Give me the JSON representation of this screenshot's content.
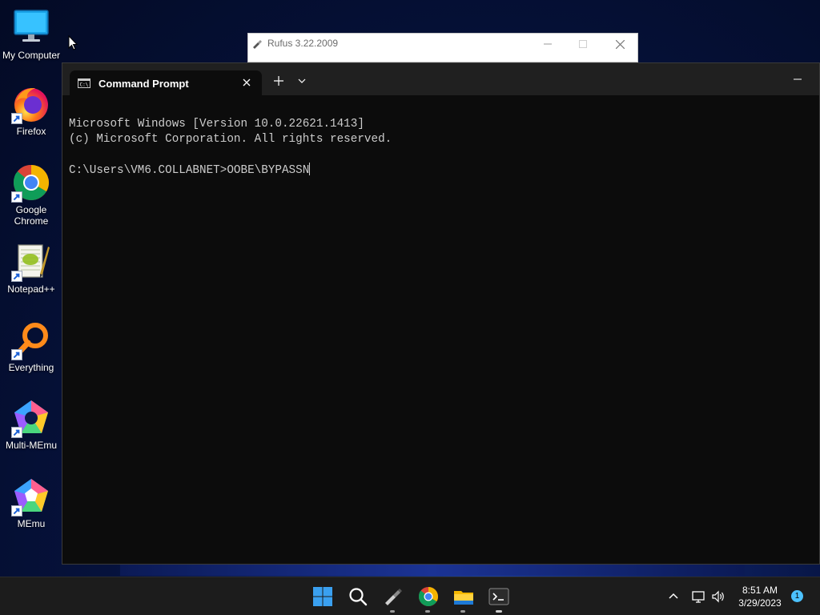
{
  "desktop": {
    "icons": [
      {
        "label": "My Computer",
        "icon": "monitor-icon"
      },
      {
        "label": "Firefox",
        "icon": "firefox-icon"
      },
      {
        "label": "Google Chrome",
        "icon": "chrome-icon"
      },
      {
        "label": "Notepad++",
        "icon": "notepadpp-icon"
      },
      {
        "label": "Everything",
        "icon": "everything-search-icon"
      },
      {
        "label": "Multi-MEmu",
        "icon": "multi-memu-icon"
      },
      {
        "label": "MEmu",
        "icon": "memu-icon"
      }
    ]
  },
  "rufus": {
    "title": "Rufus 3.22.2009"
  },
  "terminal": {
    "tab_label": "Command Prompt",
    "lines": [
      "Microsoft Windows [Version 10.0.22621.1413]",
      "(c) Microsoft Corporation. All rights reserved.",
      "",
      "C:\\Users\\VM6.COLLABNET>OOBE\\BYPASSN"
    ]
  },
  "taskbar": {
    "apps": [
      "start-icon",
      "search-icon",
      "usb-drive-icon",
      "chrome-icon",
      "file-explorer-icon",
      "terminal-icon"
    ],
    "time": "8:51 AM",
    "date": "3/29/2023",
    "notification_count": "1"
  },
  "colors": {
    "terminal_bg": "#0c0c0c",
    "terminal_text": "#cccccc",
    "taskbar_bg": "#1c1c1c",
    "accent": "#4cc2ff"
  }
}
